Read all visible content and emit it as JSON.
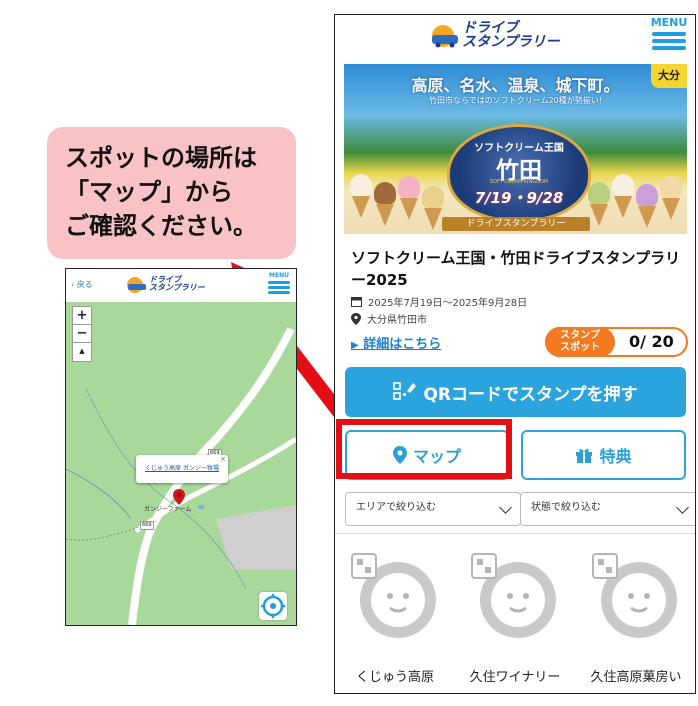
{
  "callout": {
    "lines": [
      "スポットの場所は",
      "「マップ」から",
      "ご確認ください。"
    ]
  },
  "main": {
    "logo_text": {
      "line1": "ドライブ",
      "line2": "スタンプラリー"
    },
    "menu_label": "MENU",
    "banner": {
      "headline": "高原、名水、温泉、城下町。",
      "subline": "竹田市ならではのソフトクリーム20種が勢揃い!",
      "prefecture_tag": "大分",
      "emblem_top": "ソフトクリーム王国",
      "emblem_main": "竹田",
      "emblem_en": "SOFT CREAM KINGDOM",
      "emblem_dates": "7/19・9/28",
      "ribbon": "ドライブスタンプラリー"
    },
    "title": "ソフトクリーム王国・竹田ドライブスタンプラリー2025",
    "period": "2025年7月19日〜2025年9月28日",
    "location": "大分県竹田市",
    "detail_link": "詳細はこちら",
    "stamp_label_line1": "スタンプ",
    "stamp_label_line2": "スポット",
    "stamp_count": "0/ 20",
    "qr_button": "QRコードでスタンプを押す",
    "map_button": "マップ",
    "perk_button": "特典",
    "filter_area": "エリアで絞り込む",
    "filter_status": "状態で絞り込む",
    "spots": [
      "くじゅう高原",
      "久住ワイナリー",
      "久住高原菓房い"
    ]
  },
  "mini_map": {
    "back_label": "戻る",
    "menu_label": "MENU",
    "zoom_in": "+",
    "zoom_out": "−",
    "compass": "▲",
    "route_badges": [
      "669",
      "669"
    ],
    "popup_text": "くじゅう高原 ガンジー牧場",
    "place_label": "ガンジーファーム"
  },
  "colors": {
    "accent_blue": "#2ba3dc",
    "orange": "#f47a21",
    "highlight_red": "#e30f14",
    "callout_pink": "#f9c3c6",
    "map_green": "#a9d99a"
  }
}
